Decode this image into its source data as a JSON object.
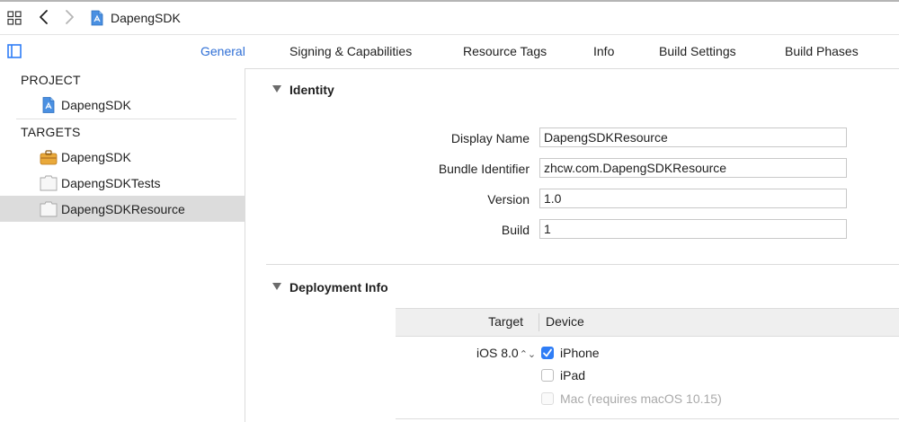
{
  "toolbar": {
    "title": "DapengSDK",
    "icons": [
      "related-items-grid-icon",
      "back-chevron-icon",
      "forward-chevron-icon",
      "project-file-icon"
    ]
  },
  "tabs": [
    {
      "label": "General",
      "active": true
    },
    {
      "label": "Signing & Capabilities",
      "active": false
    },
    {
      "label": "Resource Tags",
      "active": false
    },
    {
      "label": "Info",
      "active": false
    },
    {
      "label": "Build Settings",
      "active": false
    },
    {
      "label": "Build Phases",
      "active": false
    }
  ],
  "sidebar": {
    "project_header": "PROJECT",
    "project_item": {
      "label": "DapengSDK",
      "icon": "project-file-icon"
    },
    "targets_header": "TARGETS",
    "targets": [
      {
        "label": "DapengSDK",
        "icon": "framework-toolbox-icon",
        "selected": false
      },
      {
        "label": "DapengSDKTests",
        "icon": "bundle-target-icon",
        "selected": false
      },
      {
        "label": "DapengSDKResource",
        "icon": "bundle-target-icon",
        "selected": true
      }
    ]
  },
  "identity": {
    "title": "Identity",
    "fields": [
      {
        "label": "Display Name",
        "value": "DapengSDKResource"
      },
      {
        "label": "Bundle Identifier",
        "value": "zhcw.com.DapengSDKResource"
      },
      {
        "label": "Version",
        "value": "1.0"
      },
      {
        "label": "Build",
        "value": "1"
      }
    ]
  },
  "deployment": {
    "title": "Deployment Info",
    "col_target": "Target",
    "col_device": "Device",
    "ios_version": "iOS 8.0",
    "stepper_glyph": "⌃⌄",
    "devices": [
      {
        "label": "iPhone",
        "checked": true,
        "disabled": false
      },
      {
        "label": "iPad",
        "checked": false,
        "disabled": false
      },
      {
        "label": "Mac (requires macOS 10.15)",
        "checked": false,
        "disabled": true
      }
    ]
  },
  "colors": {
    "accent": "#2f6fd6",
    "checkbox_checked": "#2f7df6",
    "selection": "#dcdcdc"
  }
}
